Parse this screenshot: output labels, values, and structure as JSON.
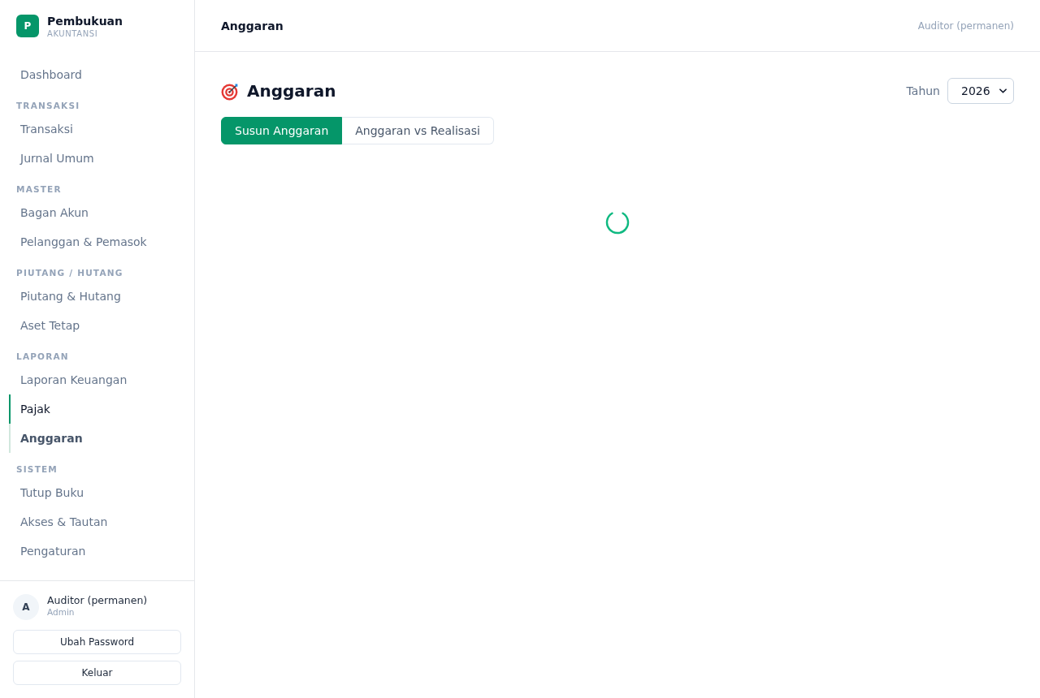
{
  "sidebar": {
    "brand": {
      "logo_letter": "P",
      "name": "Pembukuan",
      "subtitle": "AKUNTANSI"
    },
    "nav": [
      {
        "kind": "link",
        "label": "Dashboard",
        "selected": false,
        "hovered": false
      },
      {
        "kind": "section",
        "label": "TRANSAKSI",
        "items": [
          {
            "label": "Transaksi",
            "selected": false,
            "hovered": false
          },
          {
            "label": "Jurnal Umum",
            "selected": false,
            "hovered": false
          }
        ]
      },
      {
        "kind": "section",
        "label": "MASTER",
        "items": [
          {
            "label": "Bagan Akun",
            "selected": false,
            "hovered": false
          },
          {
            "label": "Pelanggan & Pemasok",
            "selected": false,
            "hovered": false
          }
        ]
      },
      {
        "kind": "section",
        "label": "PIUTANG / HUTANG",
        "items": [
          {
            "label": "Piutang & Hutang",
            "selected": false,
            "hovered": false
          },
          {
            "label": "Aset Tetap",
            "selected": false,
            "hovered": false
          }
        ]
      },
      {
        "kind": "section",
        "label": "LAPORAN",
        "items": [
          {
            "label": "Laporan Keuangan",
            "selected": false,
            "hovered": false
          },
          {
            "label": "Pajak",
            "selected": false,
            "hovered": true
          },
          {
            "label": "Anggaran",
            "selected": true,
            "hovered": false
          }
        ]
      },
      {
        "kind": "section",
        "label": "SISTEM",
        "items": [
          {
            "label": "Tutup Buku",
            "selected": false,
            "hovered": false
          },
          {
            "label": "Akses & Tautan",
            "selected": false,
            "hovered": false
          },
          {
            "label": "Pengaturan",
            "selected": false,
            "hovered": false
          }
        ]
      }
    ],
    "user": {
      "avatar_letter": "A",
      "name": "Auditor (permanen)",
      "role": "Admin"
    },
    "buttons": [
      "Ubah Password",
      "Keluar"
    ]
  },
  "header": {
    "title": "Anggaran",
    "user": "Auditor (permanen)"
  },
  "page": {
    "title": "Anggaran",
    "year_label": "Tahun",
    "year": "2026",
    "tabs": [
      {
        "label": "Susun Anggaran",
        "selected": true
      },
      {
        "label": "Anggaran vs Realisasi",
        "selected": false
      }
    ],
    "loading": true
  }
}
